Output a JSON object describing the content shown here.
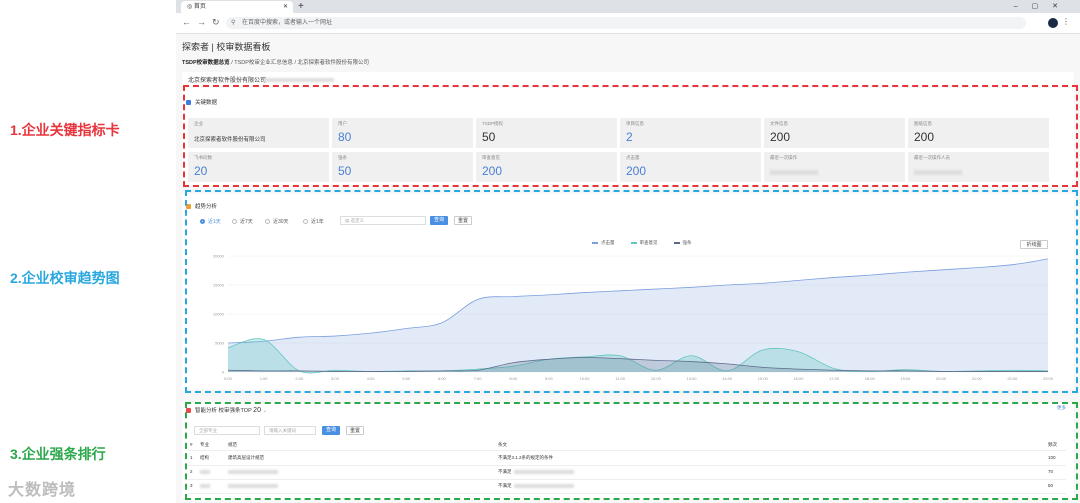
{
  "annotations": {
    "label1": "1.企业关键指标卡",
    "label2": "2.企业校审趋势图",
    "label3": "3.企业强条排行",
    "colors": {
      "label1": "#e8343c",
      "label2": "#29a8e0",
      "label3": "#2aa84a"
    }
  },
  "browser": {
    "tab_title": "首页",
    "tab_icon": "globe-icon",
    "address_placeholder": "在百度中搜索，或者输入一个网址"
  },
  "page": {
    "title": "探索者 | 校审数据看板",
    "breadcrumb": [
      "TSDP校审数据总览",
      "/",
      "TSDP校审企业汇总信息",
      "/",
      "北京探索者软件股份有限公司"
    ],
    "company_header": "北京探索者软件股份有限公司"
  },
  "key_metrics": {
    "section_title": "关键数据",
    "cards": [
      {
        "label": "企业",
        "value": "北京探索者软件股份有限公司",
        "small": true
      },
      {
        "label": "用户",
        "value": "80",
        "accent": true
      },
      {
        "label": "TSDP授权",
        "value": "50"
      },
      {
        "label": "项目信息",
        "value": "2",
        "accent": true
      },
      {
        "label": "文件信息",
        "value": "200"
      },
      {
        "label": "图纸信息",
        "value": "200"
      },
      {
        "label": "飞书问数",
        "value": "20",
        "accent": true
      },
      {
        "label": "强条",
        "value": "50",
        "accent": true
      },
      {
        "label": "审查意见",
        "value": "200",
        "accent": true
      },
      {
        "label": "点击量",
        "value": "200",
        "accent": true
      },
      {
        "label": "最近一次操作",
        "value": "",
        "blurred": true
      },
      {
        "label": "最近一次操作人员",
        "value": "",
        "blurred": true
      }
    ]
  },
  "trend": {
    "section_title": "趋势分析",
    "ranges": [
      "近1天",
      "近7天",
      "近30天",
      "近1年"
    ],
    "selected_range": "近1天",
    "date_placeholder": "选定义",
    "query_label": "查询",
    "reset_label": "重置",
    "toggle_label": "折线图"
  },
  "chart_data": {
    "type": "area",
    "x": [
      "0:00",
      "1:00",
      "2:00",
      "3:00",
      "4:00",
      "5:00",
      "6:00",
      "7:00",
      "8:00",
      "9:00",
      "10:00",
      "11:00",
      "12:00",
      "13:00",
      "14:00",
      "15:00",
      "16:00",
      "17:00",
      "18:00",
      "19:00",
      "20:00",
      "21:00",
      "22:00",
      "23:00"
    ],
    "ylim": [
      0,
      20000
    ],
    "yticks": [
      "20000",
      "15000",
      "10000",
      "5000",
      "0"
    ],
    "series": [
      {
        "name": "点击量",
        "color": "#7b9ee0",
        "values": [
          5000,
          5300,
          6000,
          6200,
          6700,
          7500,
          8500,
          12500,
          13000,
          13300,
          13700,
          14000,
          14300,
          14600,
          15000,
          15300,
          15800,
          16300,
          16700,
          17200,
          17600,
          18000,
          18500,
          19500
        ]
      },
      {
        "name": "审查意见",
        "color": "#5fc6bd",
        "values": [
          4200,
          5600,
          200,
          300,
          100,
          200,
          200,
          500,
          1000,
          2200,
          2600,
          2800,
          300,
          2800,
          200,
          3800,
          3500,
          600,
          100,
          400,
          100,
          200,
          300,
          200
        ]
      },
      {
        "name": "强条",
        "color": "#5b6b8a",
        "values": [
          300,
          200,
          200,
          100,
          100,
          100,
          200,
          300,
          1600,
          2200,
          2500,
          2300,
          2000,
          1800,
          1400,
          800,
          500,
          300,
          200,
          200,
          100,
          100,
          100,
          100
        ]
      }
    ]
  },
  "ranking": {
    "section_title": "智能分析 校审强条TOP",
    "top_n": "20",
    "more_label": "更多",
    "spec_placeholder": "全部专业",
    "keyword_placeholder": "请输入关键词",
    "query_label": "查询",
    "reset_label": "重置",
    "headers": [
      "#",
      "专业",
      "规范",
      "条文",
      "频次"
    ],
    "rows": [
      {
        "no": "1",
        "major": "结构",
        "spec": "建筑高层设计规范",
        "clause": "不满足3.1.2条的规定的条件",
        "count": "100"
      },
      {
        "no": "2",
        "major": "",
        "spec": "",
        "clause": "不满足",
        "count": "70"
      },
      {
        "no": "3",
        "major": "",
        "spec": "",
        "clause": "不满足",
        "count": "50"
      }
    ]
  },
  "watermark": "大数跨境"
}
